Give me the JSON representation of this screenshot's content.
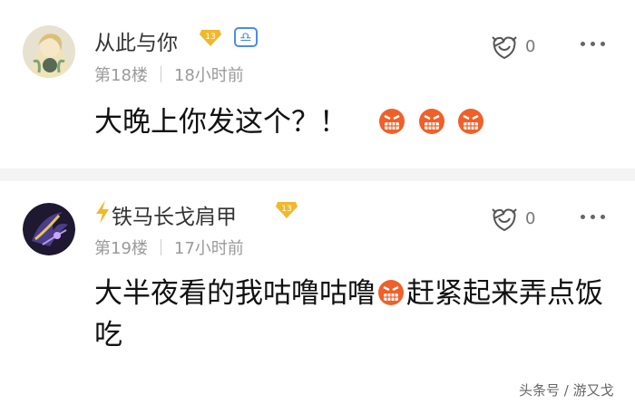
{
  "comments": [
    {
      "username": "从此与你",
      "level": "13",
      "floor": "第18楼",
      "time": "18小时前",
      "likes": "0",
      "text": "大晚上你发这个？！"
    },
    {
      "username": "铁马长戈肩甲",
      "level": "13",
      "floor": "第19楼",
      "time": "17小时前",
      "likes": "0",
      "text_part1": "大半夜看的我咕噜咕噜",
      "text_part2": "赶紧起来弄点饭吃"
    }
  ],
  "icons": {
    "zodiac": "libra-icon",
    "badge": "level-badge-icon",
    "bolt": "lightning-bolt-icon",
    "like": "like-hands-icon",
    "more": "more-dots-icon",
    "emoji": "angry-face-emoji"
  },
  "colors": {
    "accent_gold": "#f1b82a",
    "zodiac_blue": "#4b8ce5",
    "emoji_orange": "#f0602a",
    "meta_gray": "#9a9a9a"
  },
  "watermark": "头条号 / 游又戈"
}
